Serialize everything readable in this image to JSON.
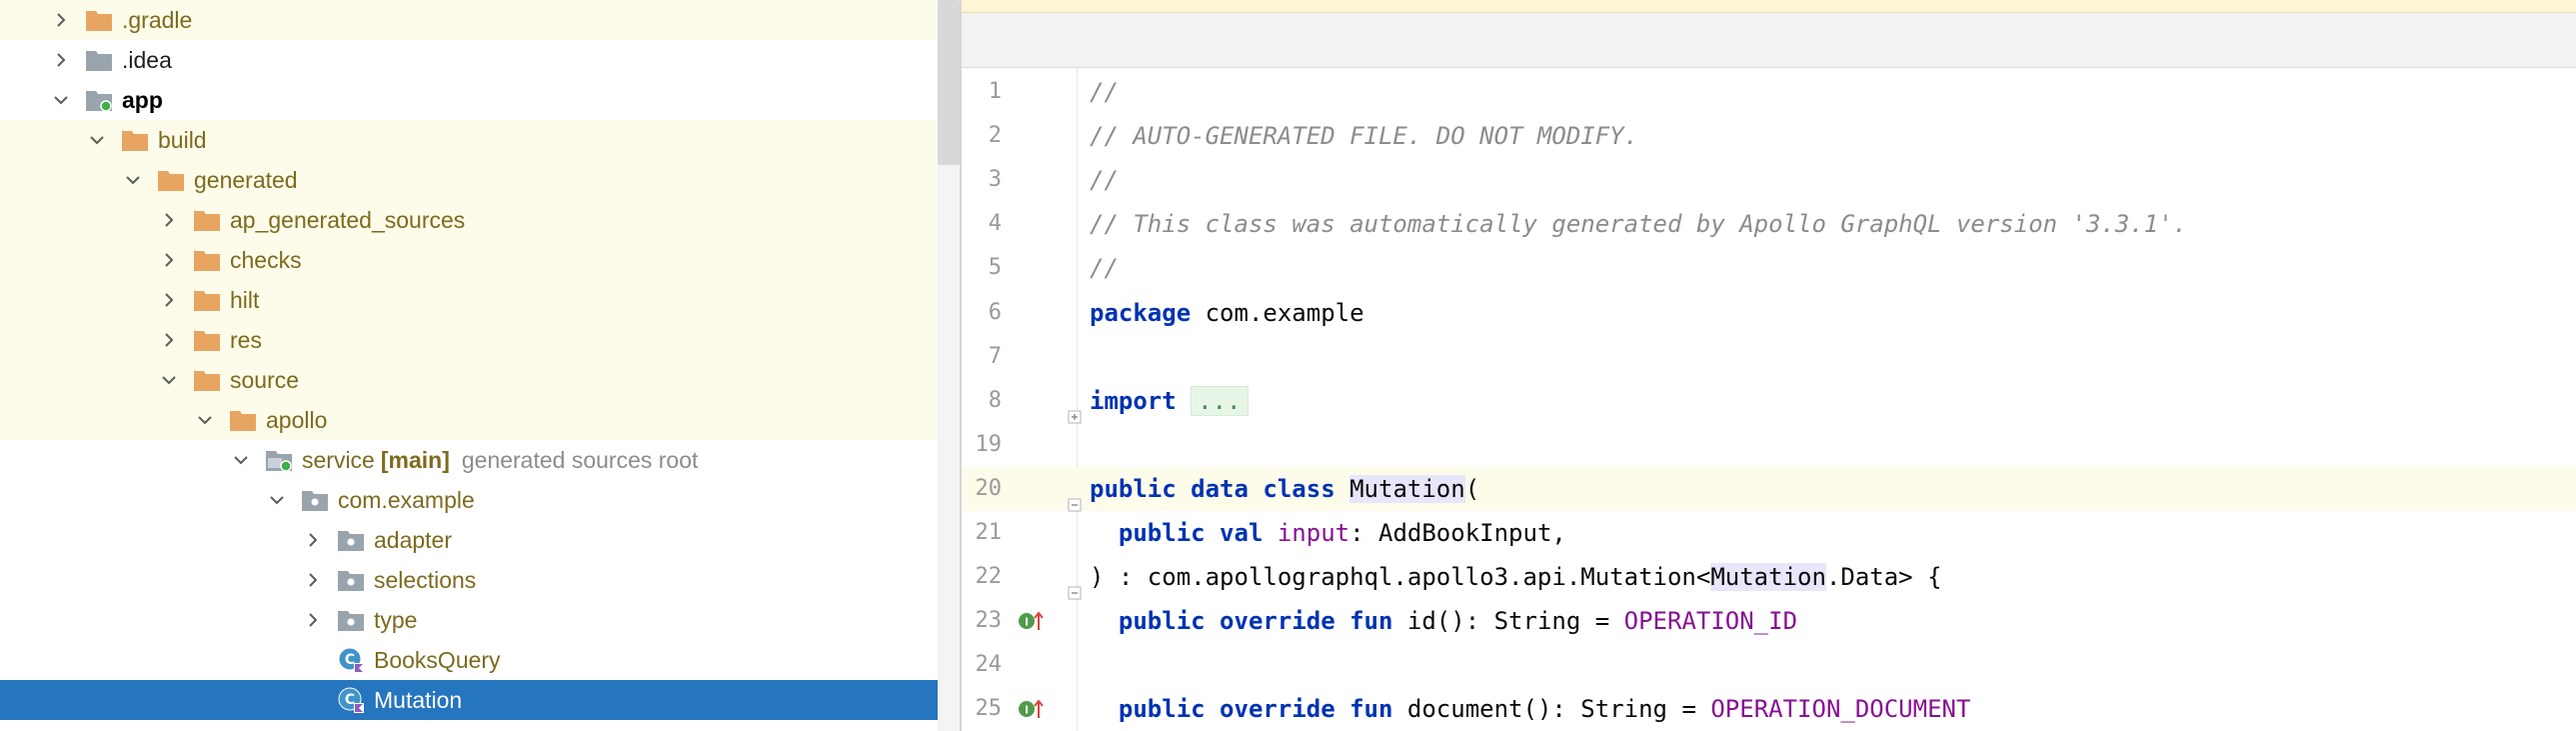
{
  "project_tree": {
    "rows": [
      {
        "label": ".gradle",
        "chevron": "right",
        "icon": "folder-orange",
        "style": "orange",
        "highlight": true
      },
      {
        "label": ".idea",
        "chevron": "right",
        "icon": "folder-gray",
        "style": "normal",
        "highlight": false
      },
      {
        "label": "app",
        "chevron": "down",
        "icon": "module-folder",
        "style": "bold",
        "highlight": false
      },
      {
        "label": "build",
        "chevron": "down",
        "icon": "folder-orange",
        "style": "orange",
        "highlight": true
      },
      {
        "label": "generated",
        "chevron": "down",
        "icon": "folder-orange",
        "style": "orange",
        "highlight": true
      },
      {
        "label": "ap_generated_sources",
        "chevron": "right",
        "icon": "folder-orange",
        "style": "orange",
        "highlight": true
      },
      {
        "label": "checks",
        "chevron": "right",
        "icon": "folder-orange",
        "style": "orange",
        "highlight": true
      },
      {
        "label": "hilt",
        "chevron": "right",
        "icon": "folder-orange",
        "style": "orange",
        "highlight": true
      },
      {
        "label": "res",
        "chevron": "right",
        "icon": "folder-orange",
        "style": "orange",
        "highlight": true
      },
      {
        "label": "source",
        "chevron": "down",
        "icon": "folder-orange",
        "style": "orange",
        "highlight": true
      },
      {
        "label": "apollo",
        "chevron": "down",
        "icon": "folder-orange",
        "style": "orange",
        "highlight": true
      },
      {
        "label": "service",
        "tag": "[main]",
        "sub": "generated sources root",
        "chevron": "down",
        "icon": "source-root-folder",
        "style": "orange",
        "highlight": false
      },
      {
        "label": "com.example",
        "chevron": "down",
        "icon": "package-folder",
        "style": "orange",
        "highlight": false
      },
      {
        "label": "adapter",
        "chevron": "right",
        "icon": "package-folder",
        "style": "orange",
        "highlight": false
      },
      {
        "label": "selections",
        "chevron": "right",
        "icon": "package-folder",
        "style": "orange",
        "highlight": false
      },
      {
        "label": "type",
        "chevron": "right",
        "icon": "package-folder",
        "style": "orange",
        "highlight": false
      },
      {
        "label": "BooksQuery",
        "chevron": "none",
        "icon": "kotlin-class-icon",
        "style": "orange",
        "highlight": false
      },
      {
        "label": "Mutation",
        "chevron": "none",
        "icon": "kotlin-class-icon",
        "style": "selected",
        "highlight": false
      }
    ]
  },
  "editor": {
    "lines": [
      {
        "num": "1",
        "tokens": [
          {
            "t": "//",
            "c": "cm"
          }
        ]
      },
      {
        "num": "2",
        "tokens": [
          {
            "t": "// AUTO-GENERATED FILE. DO NOT MODIFY.",
            "c": "cm"
          }
        ]
      },
      {
        "num": "3",
        "tokens": [
          {
            "t": "//",
            "c": "cm"
          }
        ]
      },
      {
        "num": "4",
        "tokens": [
          {
            "t": "// This class was automatically generated by Apollo GraphQL version '3.3.1'.",
            "c": "cm"
          }
        ]
      },
      {
        "num": "5",
        "tokens": [
          {
            "t": "//",
            "c": "cm"
          }
        ]
      },
      {
        "num": "6",
        "tokens": [
          {
            "t": "package",
            "c": "kw"
          },
          {
            "t": " com.example",
            "c": ""
          }
        ]
      },
      {
        "num": "7",
        "tokens": []
      },
      {
        "num": "8",
        "fold": "plus",
        "tokens": [
          {
            "t": "import",
            "c": "kw"
          },
          {
            "t": " ",
            "c": ""
          },
          {
            "t": "...",
            "c": "fold-pill"
          }
        ]
      },
      {
        "num": "19",
        "tokens": []
      },
      {
        "num": "20",
        "fold": "minus",
        "current": true,
        "tokens": [
          {
            "t": "public data class",
            "c": "kw"
          },
          {
            "t": " ",
            "c": ""
          },
          {
            "t": "Mutation",
            "c": "usage"
          },
          {
            "t": "(",
            "c": ""
          }
        ]
      },
      {
        "num": "21",
        "tokens": [
          {
            "t": "  ",
            "c": ""
          },
          {
            "t": "public val",
            "c": "kw"
          },
          {
            "t": " ",
            "c": ""
          },
          {
            "t": "input",
            "c": "purple"
          },
          {
            "t": ": AddBookInput,",
            "c": ""
          }
        ]
      },
      {
        "num": "22",
        "fold": "minus",
        "tokens": [
          {
            "t": ") : com.apollographql.apollo3.api.Mutation<",
            "c": ""
          },
          {
            "t": "Mutation",
            "c": "usage"
          },
          {
            "t": ".Data> {",
            "c": ""
          }
        ]
      },
      {
        "num": "23",
        "marker": true,
        "tokens": [
          {
            "t": "  ",
            "c": ""
          },
          {
            "t": "public override fun",
            "c": "kw"
          },
          {
            "t": " id(): String = ",
            "c": ""
          },
          {
            "t": "OPERATION_ID",
            "c": "purple"
          }
        ]
      },
      {
        "num": "24",
        "tokens": []
      },
      {
        "num": "25",
        "marker": true,
        "tokens": [
          {
            "t": "  ",
            "c": ""
          },
          {
            "t": "public override fun",
            "c": "kw"
          },
          {
            "t": " document(): String = ",
            "c": ""
          },
          {
            "t": "OPERATION_DOCUMENT",
            "c": "purple"
          }
        ]
      }
    ]
  }
}
